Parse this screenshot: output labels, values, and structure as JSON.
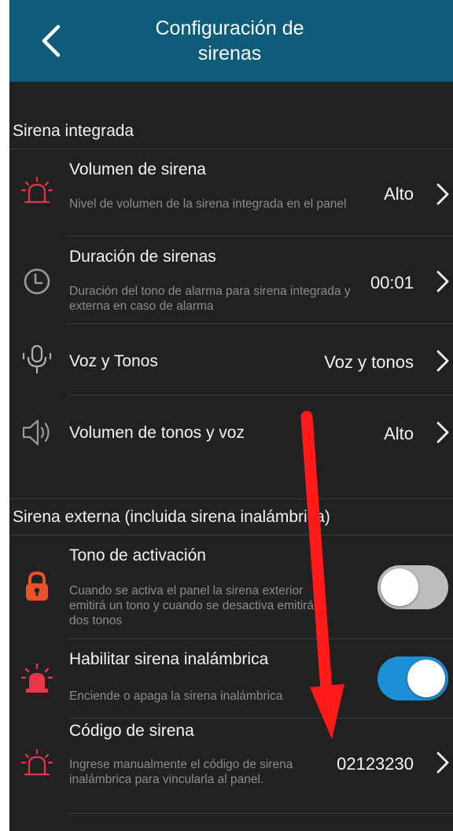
{
  "header": {
    "title_line1": "Configuración de",
    "title_line2": "sirenas",
    "back_icon": "chevron-left-icon"
  },
  "sections": {
    "integrated": {
      "label": "Sirena integrada",
      "rows": [
        {
          "title": "Volumen de sirena",
          "description": "Nivel de volumen de la sirena integrada en el panel",
          "value": "Alto",
          "icon": "siren-icon"
        },
        {
          "title": "Duración de sirenas",
          "description": "Duración del tono de alarma para sirena integrada y externa en caso de alarma",
          "value": "00:01",
          "icon": "clock-icon"
        },
        {
          "title": "Voz y Tonos",
          "value": "Voz y tonos",
          "icon": "microphone-icon"
        },
        {
          "title": "Volumen de tonos y voz",
          "value": "Alto",
          "icon": "speaker-icon"
        }
      ]
    },
    "external": {
      "label": "Sirena externa (incluida sirena inalámbrica)",
      "rows": [
        {
          "title": "Tono de activación",
          "description": "Cuando se activa el panel la sirena exterior emitirá un tono y cuando se desactiva emitirá dos tonos",
          "toggle_on": false,
          "icon": "lock-icon"
        },
        {
          "title": "Habilitar sirena inalámbrica",
          "description": "Enciende o apaga la sirena inalámbrica",
          "toggle_on": true,
          "icon": "alarm-light-icon"
        },
        {
          "title": "Código de sirena",
          "description": "Ingrese manualmente el código de sirena inalámbrica para vincularla al panel.",
          "value": "02123230",
          "icon": "siren-icon"
        }
      ]
    }
  },
  "colors": {
    "header_bg": "#0e5b7a",
    "screen_bg": "#212121",
    "toggle_on": "#1d8fd6",
    "toggle_off": "#bdbdbd",
    "siren_red": "#e8354a",
    "lock_orange": "#e8532a",
    "annotation_arrow": "#ff1a1a"
  }
}
